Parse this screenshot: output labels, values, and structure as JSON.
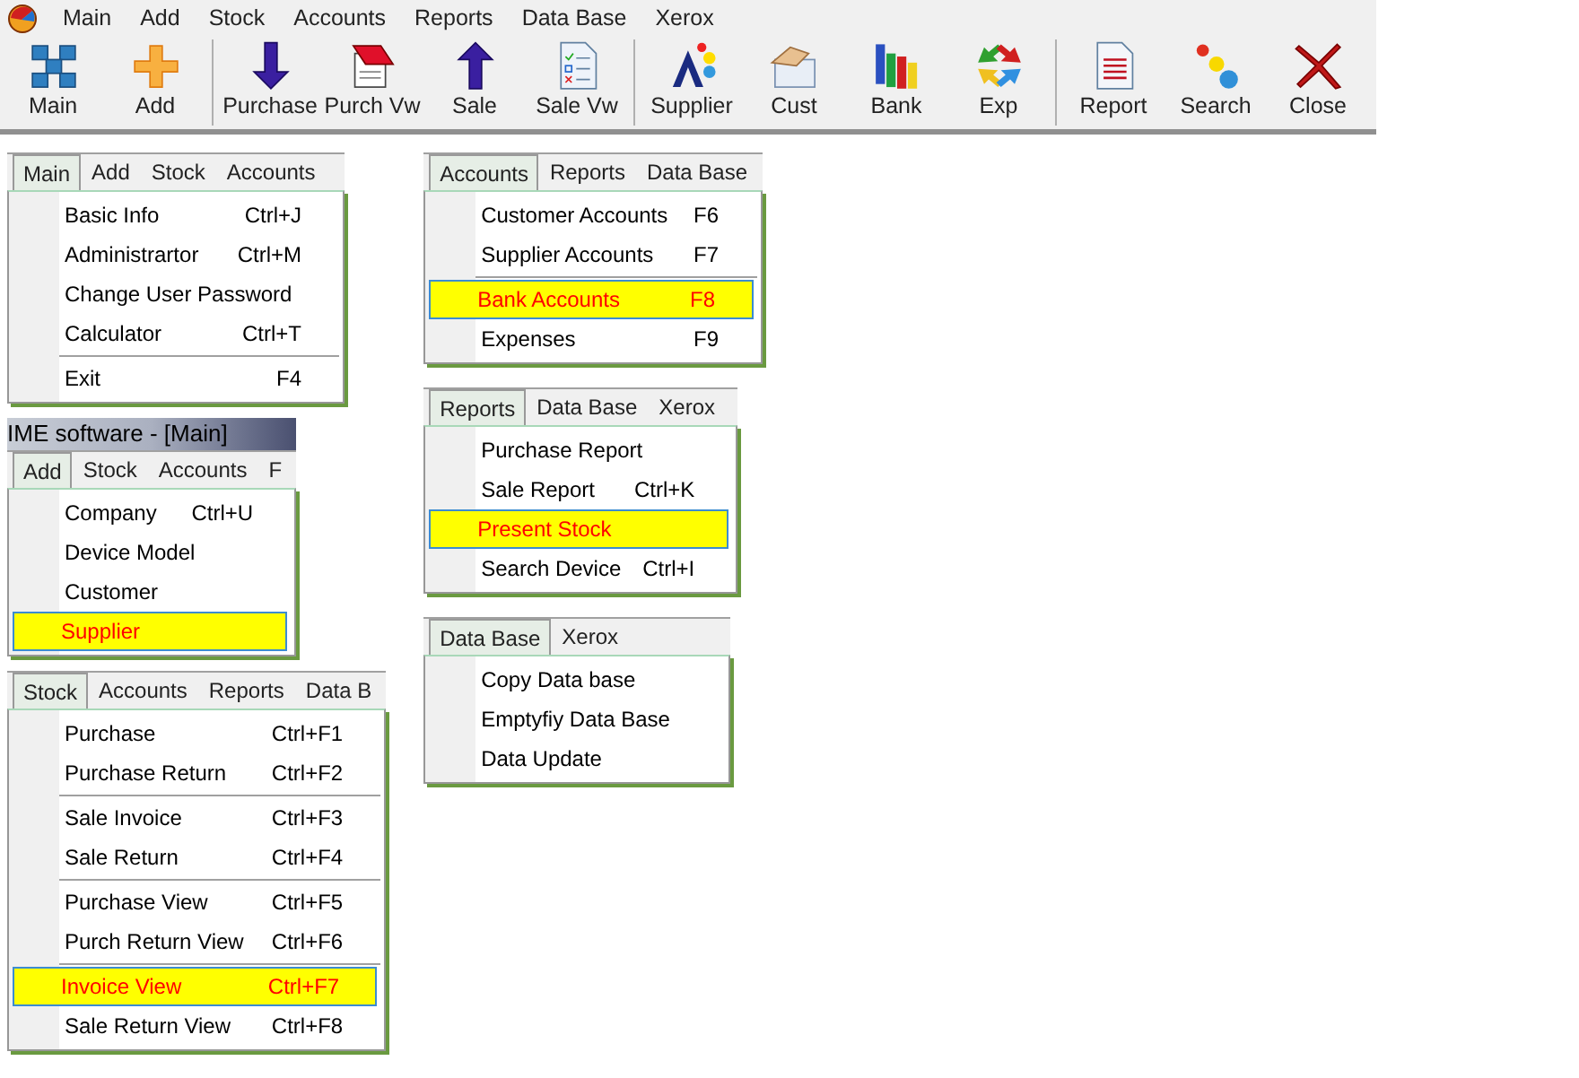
{
  "menubar": {
    "items": [
      "Main",
      "Add",
      "Stock",
      "Accounts",
      "Reports",
      "Data Base",
      "Xerox"
    ]
  },
  "toolbar": {
    "groups": [
      [
        {
          "label": "Main",
          "kind": "grid"
        },
        {
          "label": "Add",
          "kind": "plus"
        }
      ],
      [
        {
          "label": "Purchase",
          "kind": "down"
        },
        {
          "label": "Purch Vw",
          "kind": "notebook"
        },
        {
          "label": "Sale",
          "kind": "up"
        },
        {
          "label": "Sale Vw",
          "kind": "checklist"
        }
      ],
      [
        {
          "label": "Supplier",
          "kind": "shapes"
        },
        {
          "label": "Cust",
          "kind": "hand"
        },
        {
          "label": "Bank",
          "kind": "bars"
        },
        {
          "label": "Exp",
          "kind": "arrows"
        }
      ],
      [
        {
          "label": "Report",
          "kind": "report"
        },
        {
          "label": "Search",
          "kind": "dots"
        },
        {
          "label": "Close",
          "kind": "cross"
        }
      ]
    ]
  },
  "columns": [
    [
      {
        "tabs": [
          {
            "label": "Main",
            "selected": true
          },
          {
            "label": "Add",
            "selected": false
          },
          {
            "label": "Stock",
            "selected": false
          },
          {
            "label": "Accounts",
            "selected": false
          }
        ],
        "entries": [
          {
            "kind": "item",
            "label": "Basic Info",
            "shortcut": "Ctrl+J",
            "selected": false
          },
          {
            "kind": "item",
            "label": "Administrartor",
            "shortcut": "Ctrl+M",
            "selected": false
          },
          {
            "kind": "item",
            "label": "Change User Password",
            "selected": false
          },
          {
            "kind": "item",
            "label": "Calculator",
            "shortcut": "Ctrl+T",
            "selected": false
          },
          {
            "kind": "separator"
          },
          {
            "kind": "item",
            "label": "Exit",
            "shortcut": "F4",
            "selected": false
          }
        ]
      },
      {
        "title": "IME software - [Main]",
        "tabs": [
          {
            "label": "Add",
            "selected": true
          },
          {
            "label": "Stock",
            "selected": false
          },
          {
            "label": "Accounts",
            "selected": false
          },
          {
            "label": "F",
            "selected": false
          }
        ],
        "entries": [
          {
            "kind": "item",
            "label": "Company",
            "shortcut": "Ctrl+U",
            "selected": false
          },
          {
            "kind": "item",
            "label": "Device Model",
            "selected": false
          },
          {
            "kind": "item",
            "label": "Customer",
            "selected": false
          },
          {
            "kind": "item",
            "label": "Supplier",
            "selected": true
          }
        ]
      },
      {
        "tabs": [
          {
            "label": "Stock",
            "selected": true
          },
          {
            "label": "Accounts",
            "selected": false
          },
          {
            "label": "Reports",
            "selected": false
          },
          {
            "label": "Data B",
            "selected": false
          }
        ],
        "entries": [
          {
            "kind": "item",
            "label": "Purchase",
            "shortcut": "Ctrl+F1",
            "selected": false
          },
          {
            "kind": "item",
            "label": "Purchase Return",
            "shortcut": "Ctrl+F2",
            "selected": false
          },
          {
            "kind": "separator"
          },
          {
            "kind": "item",
            "label": "Sale Invoice",
            "shortcut": "Ctrl+F3",
            "selected": false
          },
          {
            "kind": "item",
            "label": "Sale Return",
            "shortcut": "Ctrl+F4",
            "selected": false
          },
          {
            "kind": "separator"
          },
          {
            "kind": "item",
            "label": "Purchase View",
            "shortcut": "Ctrl+F5",
            "selected": false
          },
          {
            "kind": "item",
            "label": "Purch Return View",
            "shortcut": "Ctrl+F6",
            "selected": false
          },
          {
            "kind": "separator"
          },
          {
            "kind": "item",
            "label": "Invoice View",
            "shortcut": "Ctrl+F7",
            "selected": true
          },
          {
            "kind": "item",
            "label": "Sale Return View",
            "shortcut": "Ctrl+F8",
            "selected": false
          }
        ]
      }
    ],
    [
      {
        "tabs": [
          {
            "label": "Accounts",
            "selected": true
          },
          {
            "label": "Reports",
            "selected": false
          },
          {
            "label": "Data Base",
            "selected": false
          }
        ],
        "entries": [
          {
            "kind": "item",
            "label": "Customer Accounts",
            "shortcut": "F6",
            "selected": false
          },
          {
            "kind": "item",
            "label": "Supplier Accounts",
            "shortcut": "F7",
            "selected": false
          },
          {
            "kind": "separator"
          },
          {
            "kind": "item",
            "label": "Bank Accounts",
            "shortcut": "F8",
            "selected": true
          },
          {
            "kind": "item",
            "label": "Expenses",
            "shortcut": "F9",
            "selected": false
          }
        ]
      },
      {
        "tabs": [
          {
            "label": "Reports",
            "selected": true
          },
          {
            "label": "Data Base",
            "selected": false
          },
          {
            "label": "Xerox",
            "selected": false
          }
        ],
        "entries": [
          {
            "kind": "item",
            "label": "Purchase Report",
            "selected": false
          },
          {
            "kind": "item",
            "label": "Sale Report",
            "shortcut": "Ctrl+K",
            "selected": false
          },
          {
            "kind": "item",
            "label": "Present Stock",
            "selected": true
          },
          {
            "kind": "item",
            "label": "Search Device",
            "shortcut": "Ctrl+I",
            "selected": false
          }
        ]
      },
      {
        "tabs": [
          {
            "label": "Data Base",
            "selected": true
          },
          {
            "label": "Xerox",
            "selected": false
          }
        ],
        "entries": [
          {
            "kind": "item",
            "label": "Copy Data base",
            "selected": false
          },
          {
            "kind": "item",
            "label": "Emptyfiy Data Base",
            "selected": false
          },
          {
            "kind": "item",
            "label": "Data Update",
            "selected": false
          }
        ]
      }
    ]
  ]
}
